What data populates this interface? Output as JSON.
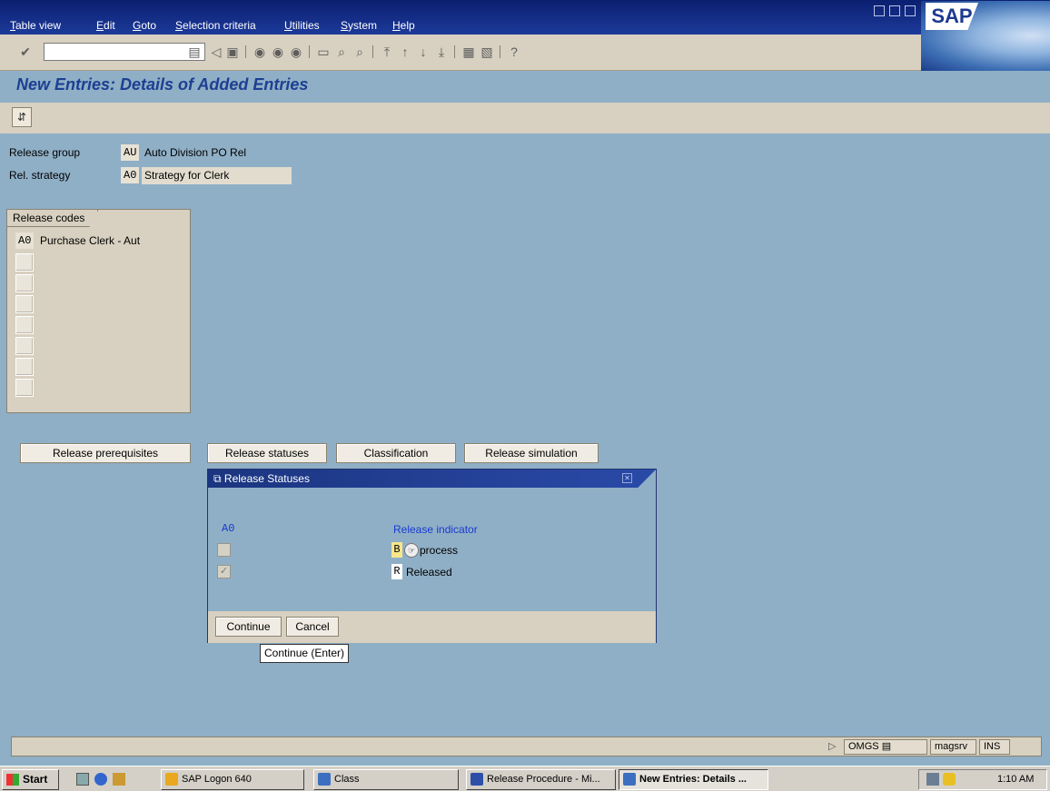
{
  "menu": [
    "Table view",
    "Edit",
    "Goto",
    "Selection criteria",
    "Utilities",
    "System",
    "Help"
  ],
  "brand": "SAP",
  "page_title": "New Entries: Details of Added Entries",
  "fields": {
    "release_group": {
      "label": "Release group",
      "code": "AU",
      "text": "Auto Division PO Rel"
    },
    "rel_strategy": {
      "label": "Rel. strategy",
      "code": "A0",
      "text": "Strategy for Clerk"
    }
  },
  "release_codes": {
    "tab_label": "Release codes",
    "rows": [
      {
        "code": "A0",
        "text": "Purchase Clerk - Aut"
      }
    ]
  },
  "buttons": {
    "prerequisites": "Release prerequisites",
    "statuses": "Release statuses",
    "classification": "Classification",
    "simulation": "Release simulation"
  },
  "dialog": {
    "title": "Release Statuses",
    "col_code": "A0",
    "col_indicator": "Release indicator",
    "rows": [
      {
        "checked": false,
        "indicator": "B",
        "text": "process"
      },
      {
        "checked": true,
        "indicator": "R",
        "text": "Released"
      }
    ],
    "continue": "Continue",
    "cancel": "Cancel",
    "tooltip": "Continue  (Enter)"
  },
  "status_bar": {
    "transaction": "OMGS",
    "server": "magsrv",
    "mode": "INS"
  },
  "taskbar": {
    "start": "Start",
    "items": [
      "SAP Logon 640",
      "Class",
      "Release Procedure - Mi...",
      "New Entries: Details ..."
    ],
    "clock": "1:10 AM"
  },
  "colors": {
    "background": "#8fafc6",
    "title_blue": "#1d3f92",
    "menubar": "#0b1f70",
    "panel": "#d8d0c0"
  }
}
